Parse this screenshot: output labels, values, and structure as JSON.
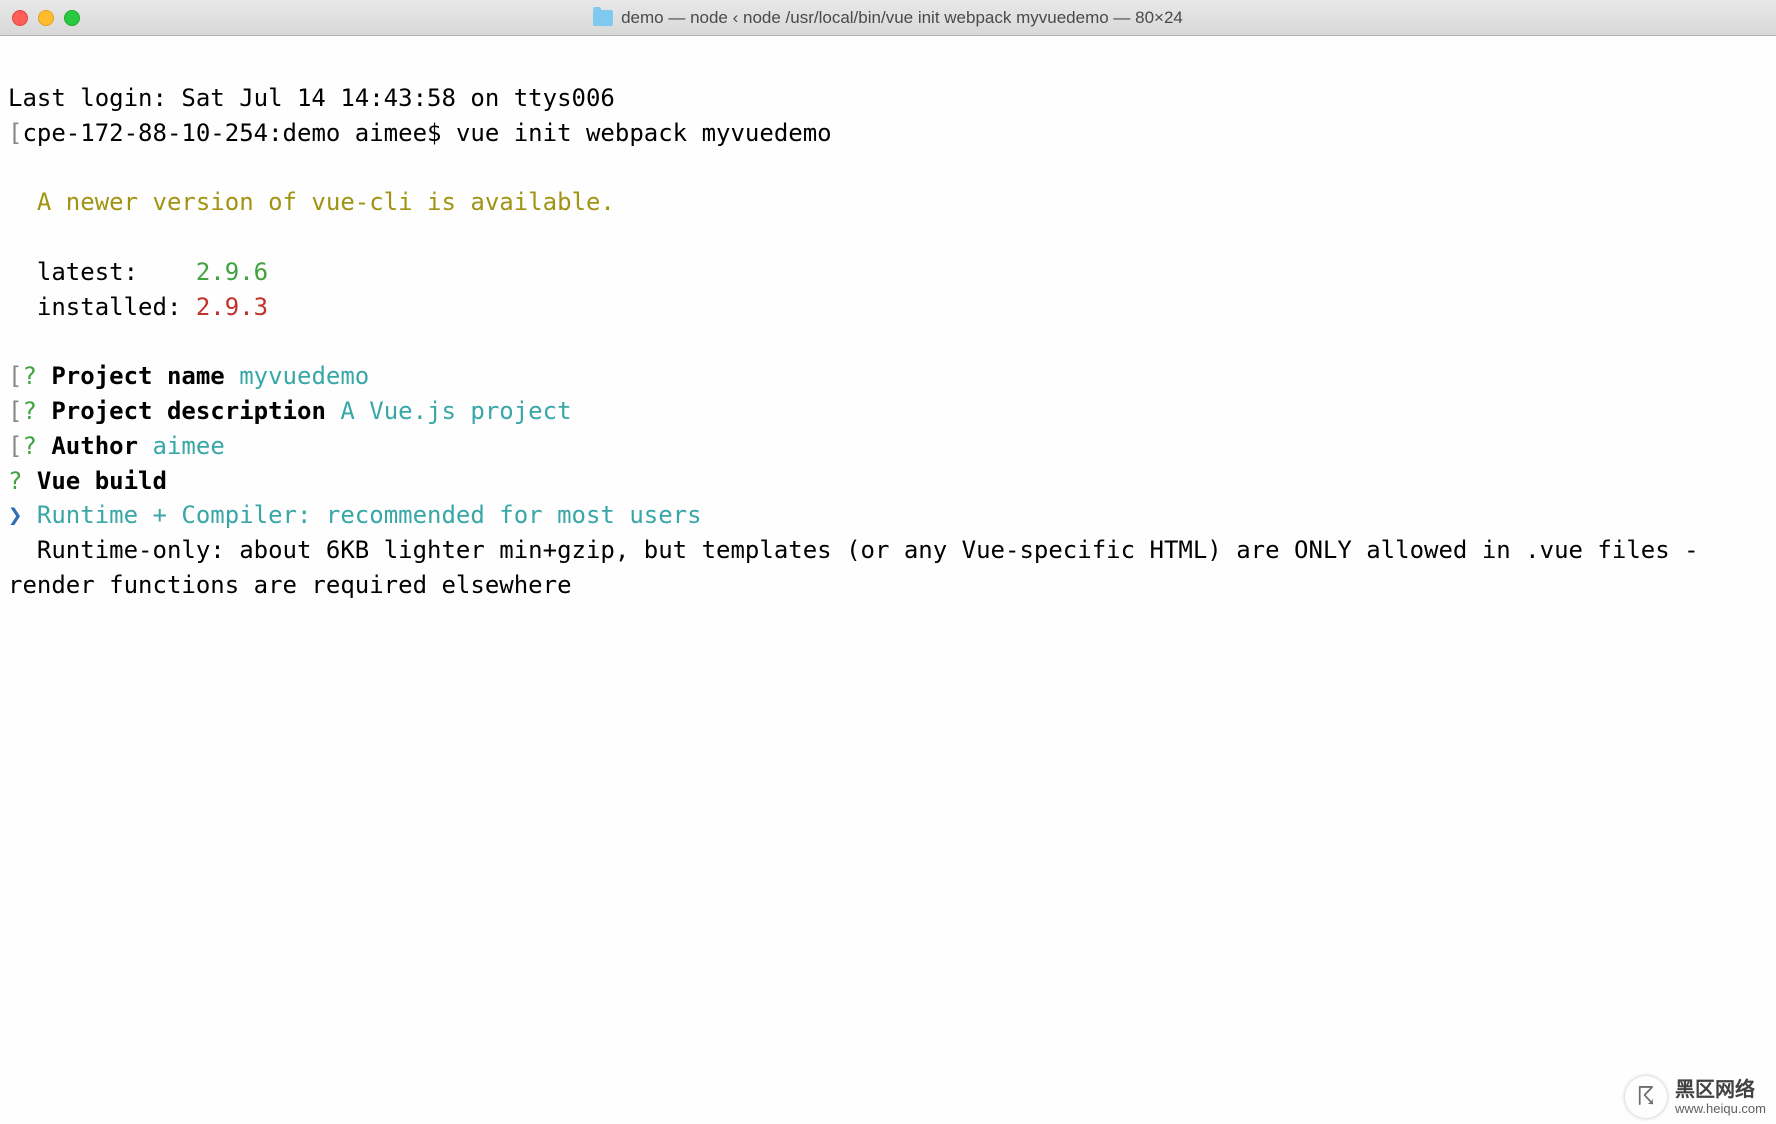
{
  "window": {
    "title": "demo — node ‹ node /usr/local/bin/vue init webpack myvuedemo — 80×24"
  },
  "terminal": {
    "last_login": "Last login: Sat Jul 14 14:43:58 on ttys006",
    "prompt": "cpe-172-88-10-254:demo aimee$ ",
    "command": "vue init webpack myvuedemo",
    "notice": "  A newer version of vue-cli is available.",
    "latest_label": "  latest:    ",
    "latest_value": "2.9.6",
    "installed_label": "  installed: ",
    "installed_value": "2.9.3",
    "q1_marker": "? ",
    "q1_label": "Project name ",
    "q1_value": "myvuedemo",
    "q2_marker": "? ",
    "q2_label": "Project description ",
    "q2_value": "A Vue.js project",
    "q3_marker": "? ",
    "q3_label": "Author ",
    "q3_value": "aimee",
    "q4_marker": "? ",
    "q4_label": "Vue build ",
    "opt_arrow": "❯ ",
    "opt1": "Runtime + Compiler: recommended for most users",
    "opt2": "  Runtime-only: about 6KB lighter min+gzip, but templates (or any Vue-specific HTML) are ONLY allowed in .vue files - render functions are required elsewhere"
  },
  "watermark": {
    "brand": "黑区网络",
    "url": "www.heiqu.com"
  }
}
